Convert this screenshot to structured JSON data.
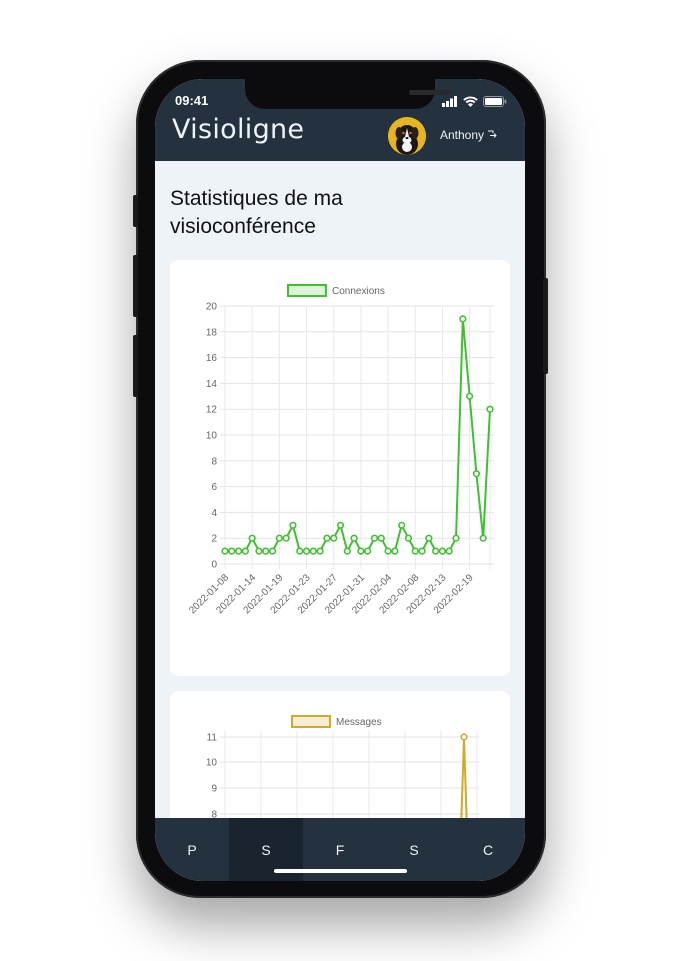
{
  "status_bar": {
    "time": "09:41"
  },
  "app": {
    "title": "Visioligne",
    "user_name": "Anthony"
  },
  "page": {
    "title": "Statistiques de ma visioconférence"
  },
  "tabs": [
    "P",
    "S",
    "F",
    "S",
    "C"
  ],
  "active_tab_index": 1,
  "colors": {
    "appbar": "#24313f",
    "connexions": "#3ec12e",
    "messages": "#d4a82a",
    "background": "#eef3f8"
  },
  "chart_data": [
    {
      "type": "line",
      "legend": [
        "Connexions"
      ],
      "legend_position": "top",
      "grid": true,
      "ylim": [
        0,
        20
      ],
      "y_ticks": [
        "0",
        "2",
        "4",
        "6",
        "8",
        "10",
        "12",
        "14",
        "16",
        "18",
        "20"
      ],
      "x_tick_labels": [
        "2022-01-08",
        "2022-01-14",
        "2022-01-19",
        "2022-01-23",
        "2022-01-27",
        "2022-01-31",
        "2022-02-04",
        "2022-02-08",
        "2022-02-13",
        "2022-02-19"
      ],
      "series": [
        {
          "name": "Connexions",
          "values": [
            1,
            1,
            1,
            1,
            2,
            1,
            1,
            1,
            2,
            2,
            3,
            1,
            1,
            1,
            1,
            2,
            2,
            3,
            1,
            2,
            1,
            1,
            2,
            2,
            1,
            1,
            3,
            2,
            1,
            1,
            2,
            1,
            1,
            1,
            2,
            19,
            13,
            7,
            2,
            12
          ]
        }
      ]
    },
    {
      "type": "line",
      "legend": [
        "Messages"
      ],
      "legend_position": "top",
      "grid": true,
      "y_ticks": [
        "11",
        "10",
        "9",
        "8"
      ],
      "series": [
        {
          "name": "Messages",
          "peak_value": 11
        }
      ]
    }
  ]
}
